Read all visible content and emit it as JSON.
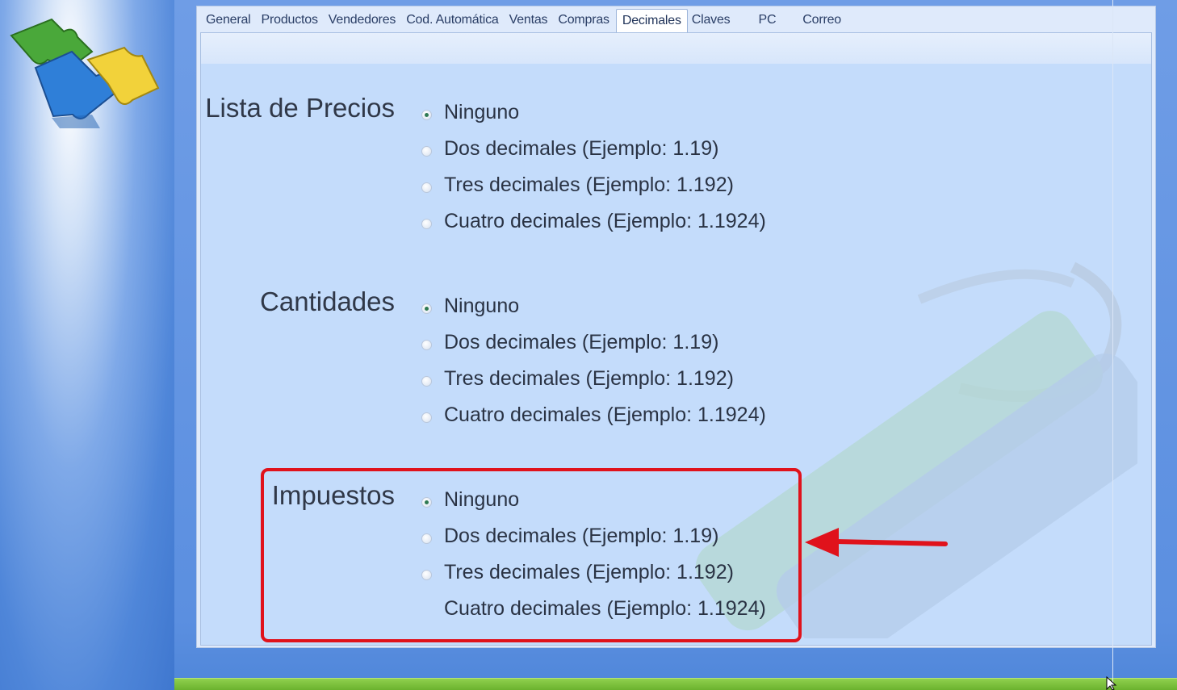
{
  "tabs": [
    "General",
    "Productos",
    "Vendedores",
    "Cod. Automática",
    "Ventas",
    "Compras",
    "Decimales",
    "Claves",
    "PC",
    "Correo"
  ],
  "active_tab": "Decimales",
  "groups": [
    {
      "label": "Lista de Precios",
      "options": [
        "Ninguno",
        "Dos decimales (Ejemplo:  1.19)",
        "Tres decimales (Ejemplo:  1.192)",
        "Cuatro decimales (Ejemplo:  1.1924)"
      ],
      "selected": 0
    },
    {
      "label": "Cantidades",
      "options": [
        "Ninguno",
        "Dos decimales (Ejemplo: 1.19)",
        "Tres decimales (Ejemplo: 1.192)",
        "Cuatro decimales (Ejemplo: 1.1924)"
      ],
      "selected": 0
    },
    {
      "label": "Impuestos",
      "options": [
        "Ninguno",
        "Dos decimales (Ejemplo: 1.19)",
        "Tres decimales (Ejemplo: 1.192)",
        "Cuatro decimales (Ejemplo: 1.1924)"
      ],
      "selected": 0
    }
  ],
  "colors": {
    "highlight": "#e0121b",
    "radio_checked": "#2f7a52",
    "panel": "#c4dcfb"
  },
  "icons": [
    "puzzle-logo-icon",
    "arrow-pointer-icon",
    "mouse-cursor-icon"
  ]
}
